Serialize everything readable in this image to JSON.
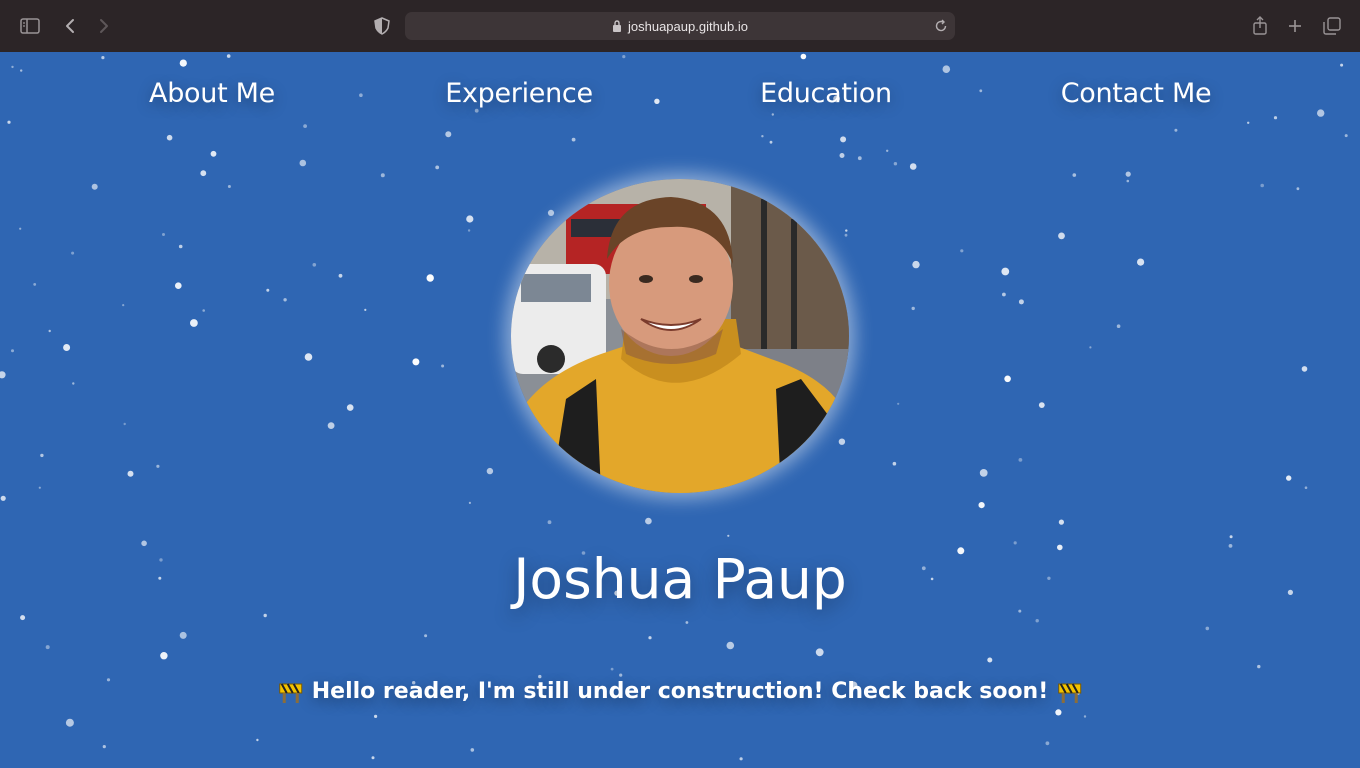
{
  "browser": {
    "url": "joshuapaup.github.io",
    "icons": [
      "sidebar-icon",
      "back-icon",
      "forward-icon",
      "shield-icon",
      "lock-icon",
      "reload-icon",
      "share-icon",
      "new-tab-icon",
      "tabs-overview-icon"
    ]
  },
  "nav": {
    "items": [
      {
        "label": "About Me"
      },
      {
        "label": "Experience"
      },
      {
        "label": "Education"
      },
      {
        "label": "Contact Me"
      }
    ]
  },
  "hero": {
    "name": "Joshua Paup",
    "notice": "Hello reader, I'm still under construction! Check back soon!"
  },
  "colors": {
    "background": "#2f66b3",
    "toolbar": "#2c2527",
    "text": "#ffffff"
  }
}
